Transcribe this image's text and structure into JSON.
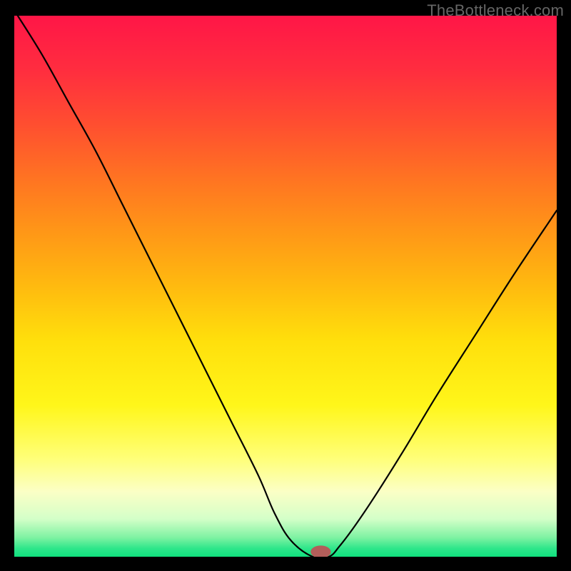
{
  "watermark": "TheBottleneck.com",
  "gradient": {
    "stops": [
      {
        "offset": 0.0,
        "color": "#ff1647"
      },
      {
        "offset": 0.1,
        "color": "#ff2d3f"
      },
      {
        "offset": 0.2,
        "color": "#ff4e30"
      },
      {
        "offset": 0.3,
        "color": "#ff7322"
      },
      {
        "offset": 0.4,
        "color": "#ff9717"
      },
      {
        "offset": 0.5,
        "color": "#ffba0f"
      },
      {
        "offset": 0.6,
        "color": "#ffdf0c"
      },
      {
        "offset": 0.72,
        "color": "#fff61a"
      },
      {
        "offset": 0.82,
        "color": "#ffff7a"
      },
      {
        "offset": 0.88,
        "color": "#fbffc6"
      },
      {
        "offset": 0.93,
        "color": "#d4ffc8"
      },
      {
        "offset": 0.965,
        "color": "#7df2a2"
      },
      {
        "offset": 0.985,
        "color": "#2de68a"
      },
      {
        "offset": 1.0,
        "color": "#10e07e"
      }
    ]
  },
  "chart_data": {
    "type": "line",
    "title": "",
    "xlabel": "",
    "ylabel": "",
    "xlim": [
      0,
      100
    ],
    "ylim": [
      0,
      100
    ],
    "series": [
      {
        "name": "bottleneck-curve",
        "x": [
          0,
          5,
          10,
          15,
          20,
          25,
          30,
          35,
          40,
          45,
          48,
          51,
          55,
          58,
          60,
          63,
          67,
          72,
          78,
          85,
          92,
          100
        ],
        "y": [
          101,
          93,
          84,
          75,
          65,
          55,
          45,
          35,
          25,
          15,
          8,
          3,
          0,
          0,
          2,
          6,
          12,
          20,
          30,
          41,
          52,
          64
        ]
      }
    ],
    "marker": {
      "x": 56.5,
      "y": 0.9,
      "rx": 1.8,
      "ry": 1.1,
      "color": "#b35e5a"
    }
  }
}
